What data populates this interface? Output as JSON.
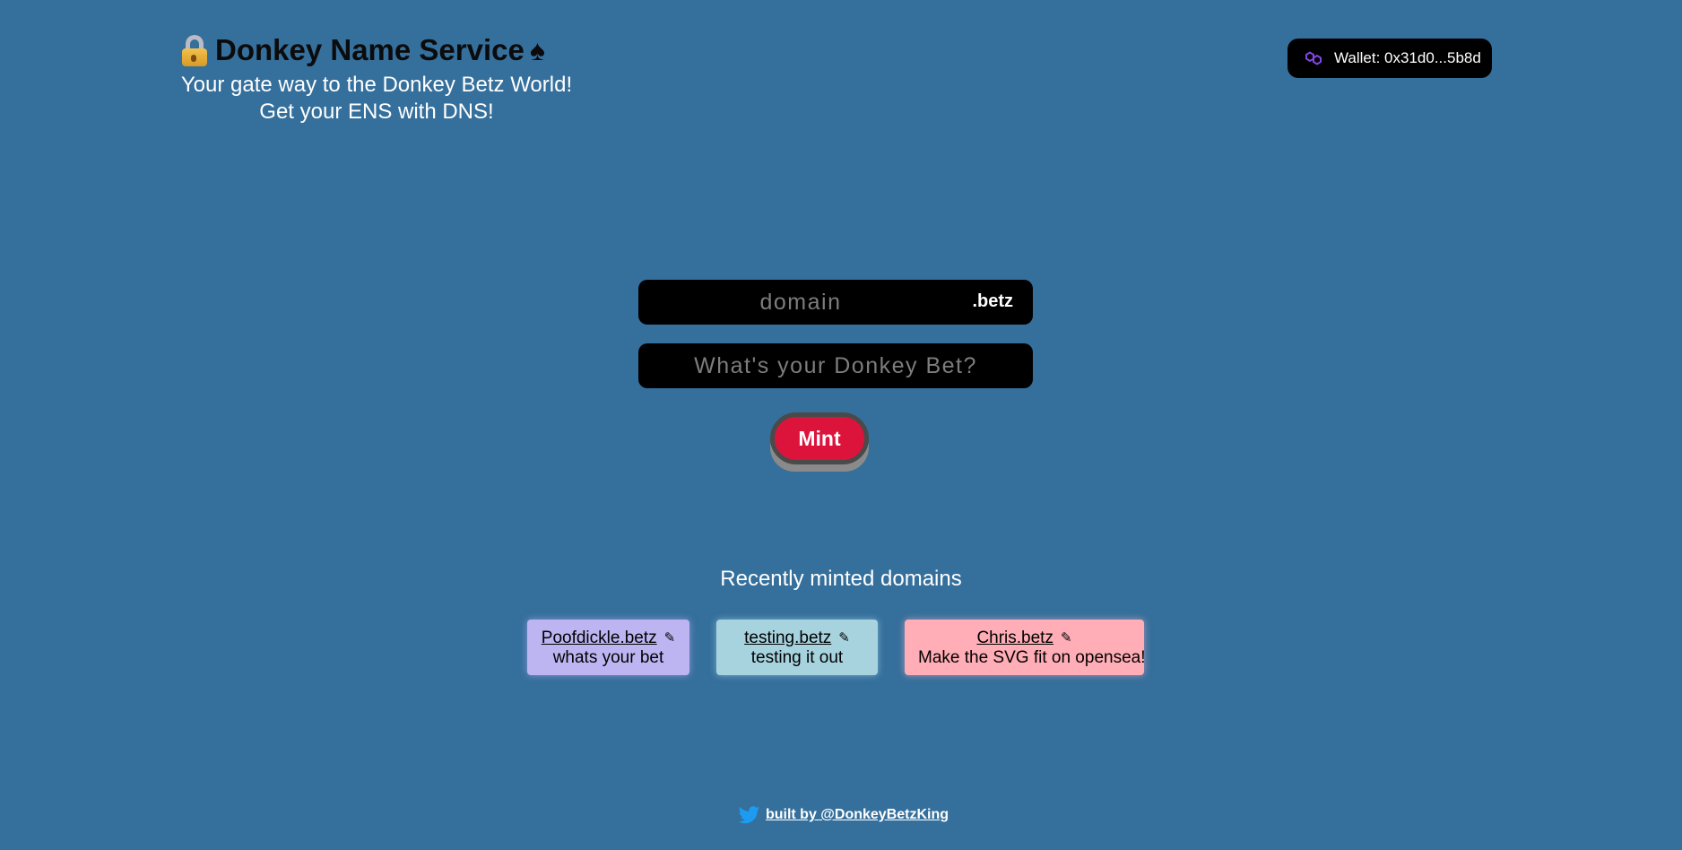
{
  "header": {
    "title": "Donkey Name Service",
    "tagline_line1": "Your gate way to the Donkey Betz World!",
    "tagline_line2": "Get your ENS with DNS!",
    "lock_icon": "lock-with-key-icon",
    "spade_icon": "spade-icon",
    "spade_glyph": "♠"
  },
  "wallet": {
    "label": "Wallet: 0x31d0...5b8d",
    "icon": "polygon-icon"
  },
  "form": {
    "domain_placeholder": "domain",
    "tld": ".betz",
    "record_placeholder": "What's your Donkey Bet?",
    "mint_label": "Mint"
  },
  "recent": {
    "title": "Recently minted domains",
    "items": [
      {
        "name": "Poofdickle.betz",
        "record": "whats your bet",
        "color": "#bcb5f2"
      },
      {
        "name": "testing.betz",
        "record": "testing it out",
        "color": "#a6d3de"
      },
      {
        "name": "Chris.betz",
        "record": "Make the SVG fit on opensea!",
        "color": "#ffadb6"
      }
    ]
  },
  "footer": {
    "link_text": "built by @DonkeyBetzKing",
    "icon": "twitter-icon"
  },
  "colors": {
    "background": "#356f9c",
    "mint_button": "#dc143c",
    "input_background": "#000000"
  }
}
